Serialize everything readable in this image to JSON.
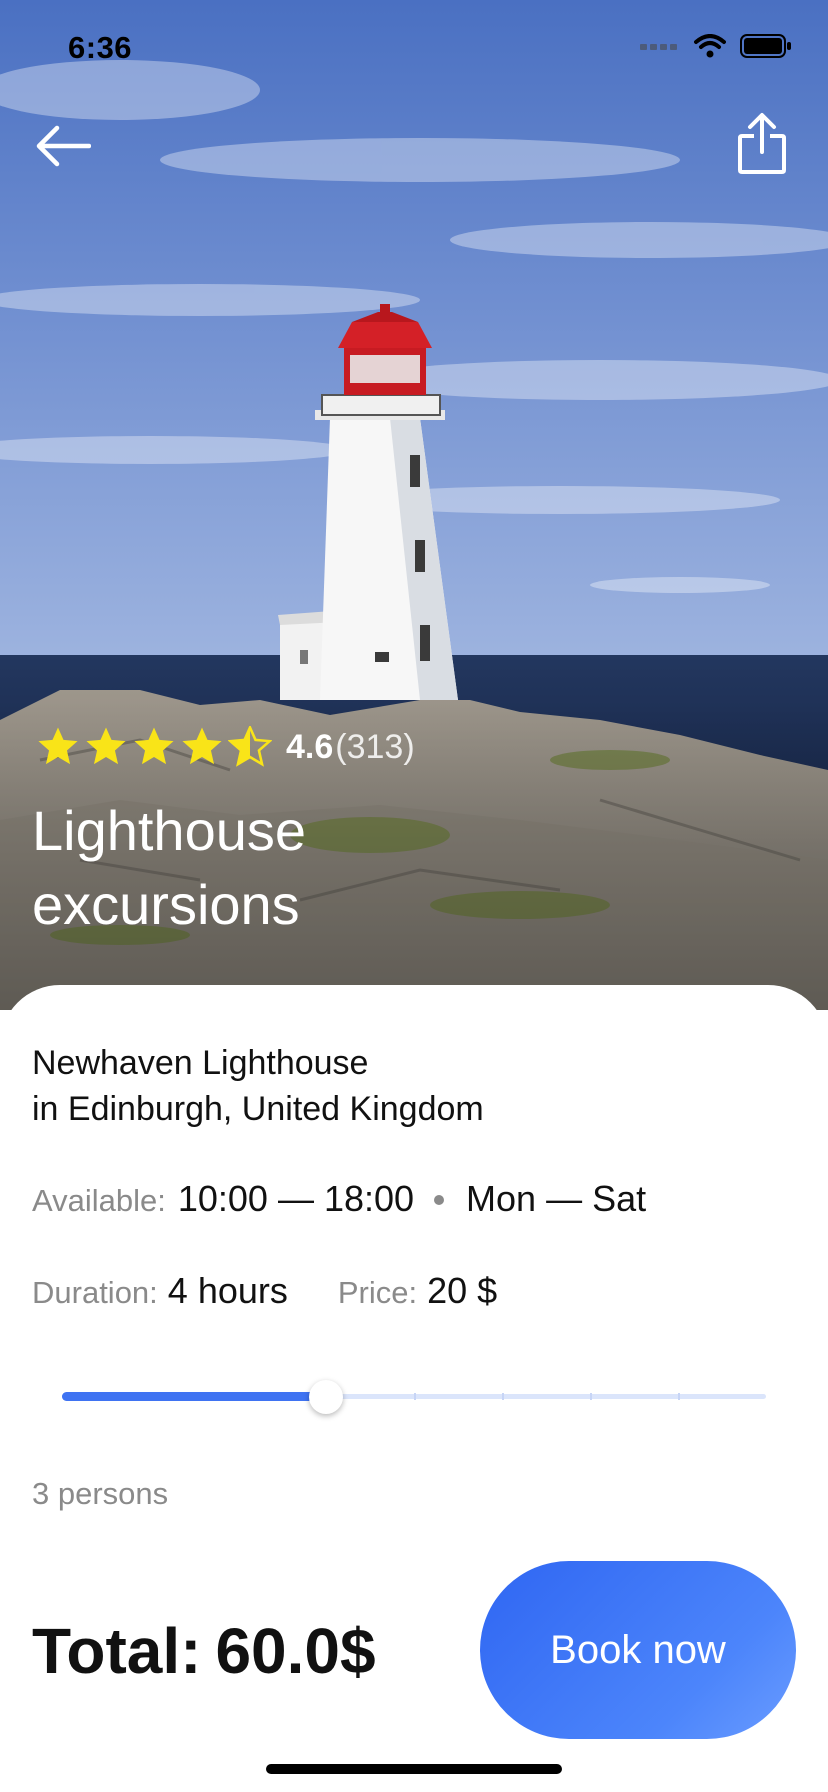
{
  "status_bar": {
    "time": "6:36"
  },
  "header": {
    "back_icon": "arrow-left-icon",
    "share_icon": "share-icon"
  },
  "rating": {
    "value": "4.6",
    "count": "(313)",
    "stars": 4.5,
    "star_color": "#f9e418"
  },
  "title": "Lighthouse excursions",
  "location": {
    "line1": "Newhaven Lighthouse",
    "line2": "in Edinburgh, United Kingdom"
  },
  "availability": {
    "label": "Available:",
    "hours": "10:00 — 18:00",
    "days": "Mon — Sat"
  },
  "duration": {
    "label": "Duration:",
    "value": "4 hours"
  },
  "price": {
    "label": "Price:",
    "value": "20 $"
  },
  "persons_slider": {
    "value": 3,
    "min": 0,
    "max": 8,
    "label": "3 persons"
  },
  "total": {
    "label": "Total:",
    "value": "60.0$"
  },
  "book_button": {
    "label": "Book now"
  },
  "colors": {
    "accent": "#3f73f2",
    "muted": "#8a8a8a",
    "text": "#111111"
  }
}
